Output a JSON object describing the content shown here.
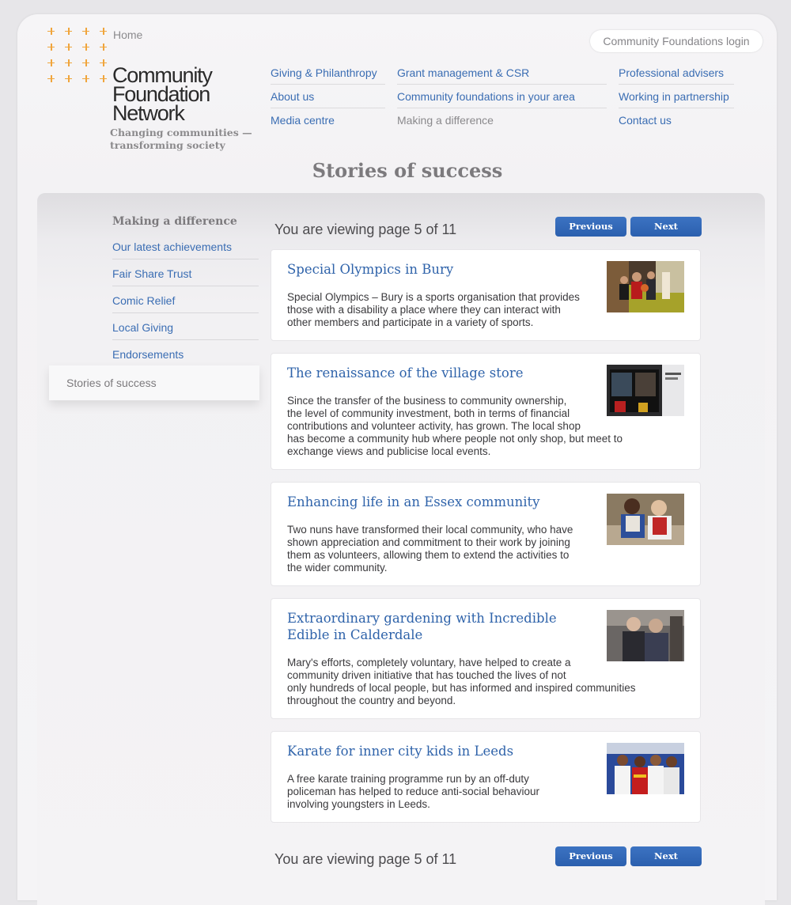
{
  "header": {
    "home": "Home",
    "login": "Community Foundations login",
    "logo": {
      "line1": "Community",
      "line2": "Foundation",
      "line3": "Network",
      "tag1": "Changing communities —",
      "tag2": "transforming society"
    },
    "accent": "#f0a53c",
    "link_color": "#3a6db3"
  },
  "nav": {
    "col1": [
      "Giving & Philanthropy",
      "About us",
      "Media centre"
    ],
    "col2": [
      "Grant management & CSR",
      "Community foundations in your area",
      "Making a difference"
    ],
    "col3": [
      "Professional advisers",
      "Working in partnership",
      "Contact us"
    ]
  },
  "page_title": "Stories of success",
  "sidebar": {
    "heading": "Making a difference",
    "items": [
      "Our latest achievements",
      "Fair Share Trust",
      "Comic Relief",
      "Local Giving",
      "Endorsements"
    ],
    "active": "Stories of success"
  },
  "pager": {
    "text": "You are viewing page 5 of 11",
    "previous": "Previous",
    "next": "Next"
  },
  "stories": [
    {
      "title": "Special Olympics in Bury",
      "desc": [
        "Special Olympics – Bury is a sports organisation that provides",
        "those with a disability a place where they can interact with",
        "other members and participate in a variety of sports."
      ]
    },
    {
      "title": "The renaissance of the village store",
      "desc": [
        "Since the transfer of the business to community ownership,",
        "the level of community investment, both in terms of financial",
        "contributions and volunteer activity, has grown. The local shop",
        "has become a community hub where people not only shop, but meet to",
        "exchange views and publicise local events."
      ]
    },
    {
      "title": "Enhancing life in an Essex community",
      "desc": [
        "Two nuns have transformed their local community, who have",
        "shown appreciation and commitment to their work by joining",
        "them as volunteers, allowing them to extend the activities to",
        "the wider community."
      ]
    },
    {
      "title": "Extraordinary gardening with Incredible Edible in Calderdale",
      "desc": [
        "Mary's efforts, completely voluntary, have helped to create a",
        "community driven initiative that has touched the lives of not",
        "only hundreds of local people, but has informed and inspired communities",
        "throughout the country and beyond."
      ]
    },
    {
      "title": "Karate for inner city kids in Leeds",
      "desc": [
        "A free karate training programme run by an off-duty",
        "policeman has helped to reduce anti-social behaviour",
        "involving youngsters in Leeds."
      ]
    }
  ]
}
